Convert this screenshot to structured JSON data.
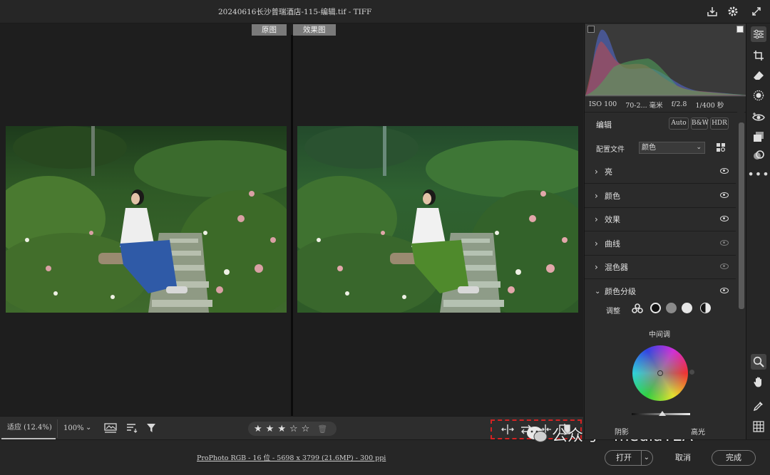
{
  "titlebar": {
    "title": "20240616长沙普瑞酒店-115-编辑.tif -  TIFF",
    "icons": [
      "save-download-icon",
      "gear-icon",
      "fullscreen-icon"
    ]
  },
  "viewer": {
    "label_before": "原图",
    "label_after": "效果图"
  },
  "filmbar": {
    "fit_label": "适应 (12.4%)",
    "zoom_label": "100%",
    "rating_stars": 3,
    "rating_max": 5
  },
  "statusbar": {
    "info": "ProPhoto RGB - 16 位 - 5698 x 3799 (21.6MP) - 300 ppi",
    "open_label": "打开",
    "cancel_label": "取消",
    "done_label": "完成"
  },
  "watermark": {
    "text": "公众号 · mediaTEA"
  },
  "panel": {
    "exif": {
      "iso": "ISO 100",
      "focal": "70-2... 毫米",
      "aperture": "f/2.8",
      "shutter": "1/400 秒"
    },
    "edit_title": "编辑",
    "buttons": {
      "auto": "Auto",
      "bw": "B&W",
      "hdr": "HDR"
    },
    "profile_label": "配置文件",
    "profile_value": "颜色",
    "sections": [
      {
        "label": "亮",
        "expanded": false,
        "visible": true
      },
      {
        "label": "颜色",
        "expanded": false,
        "visible": true
      },
      {
        "label": "效果",
        "expanded": false,
        "visible": true
      },
      {
        "label": "曲线",
        "expanded": false,
        "visible": false
      },
      {
        "label": "混色器",
        "expanded": false,
        "visible": false
      },
      {
        "label": "颜色分级",
        "expanded": true,
        "visible": true
      }
    ],
    "grading": {
      "adjust_label": "调整",
      "midtones_label": "中间调",
      "shadows_label": "阴影",
      "highlights_label": "高光"
    }
  },
  "tools": [
    "edit-sliders-icon",
    "crop-icon",
    "eraser-icon",
    "mask-icon",
    "redeye-icon",
    "presets-icon",
    "snapshots-icon",
    "more-icon",
    "zoom-icon",
    "hand-icon",
    "eyedropper-icon",
    "grid-icon"
  ],
  "colors": {
    "accent": "#d42222",
    "panel_bg": "#2b2b2b",
    "viewer_bg": "#1e1e1e"
  }
}
